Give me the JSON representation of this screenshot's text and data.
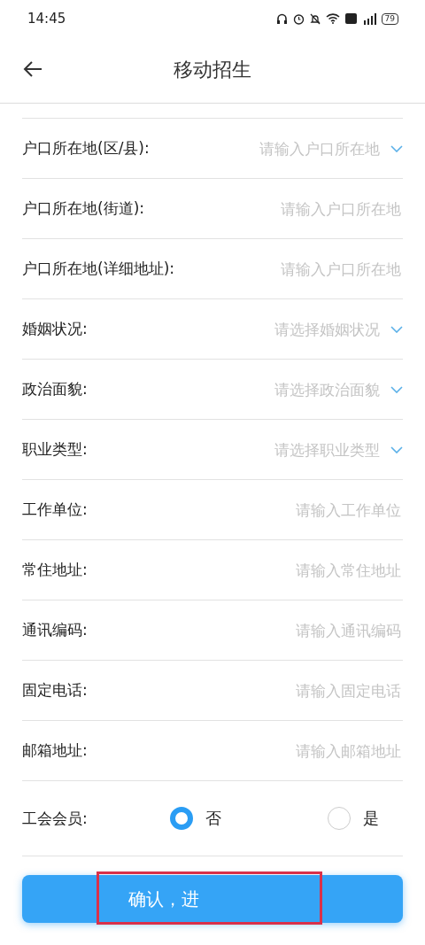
{
  "status_bar": {
    "time": "14:45",
    "battery": "79"
  },
  "header": {
    "title": "移动招生"
  },
  "fields": [
    {
      "kind": "dropdown",
      "label": "户口所在地(区/县):",
      "placeholder": "请输入户口所在地"
    },
    {
      "kind": "input",
      "label": "户口所在地(街道):",
      "placeholder": "请输入户口所在地"
    },
    {
      "kind": "input",
      "label": "户口所在地(详细地址):",
      "placeholder": "请输入户口所在地"
    },
    {
      "kind": "dropdown",
      "label": "婚姻状况:",
      "placeholder": "请选择婚姻状况"
    },
    {
      "kind": "dropdown",
      "label": "政治面貌:",
      "placeholder": "请选择政治面貌"
    },
    {
      "kind": "dropdown",
      "label": "职业类型:",
      "placeholder": "请选择职业类型"
    },
    {
      "kind": "input",
      "label": "工作单位:",
      "placeholder": "请输入工作单位"
    },
    {
      "kind": "input",
      "label": "常住地址:",
      "placeholder": "请输入常住地址"
    },
    {
      "kind": "input",
      "label": "通讯编码:",
      "placeholder": "请输入通讯编码"
    },
    {
      "kind": "input",
      "label": "固定电话:",
      "placeholder": "请输入固定电话"
    },
    {
      "kind": "input",
      "label": "邮箱地址:",
      "placeholder": "请输入邮箱地址"
    }
  ],
  "union_member": {
    "label": "工会会员:",
    "options": [
      {
        "label": "否",
        "selected": true
      },
      {
        "label": "是",
        "selected": false
      }
    ]
  },
  "submit_button": {
    "label": "确认，进"
  }
}
